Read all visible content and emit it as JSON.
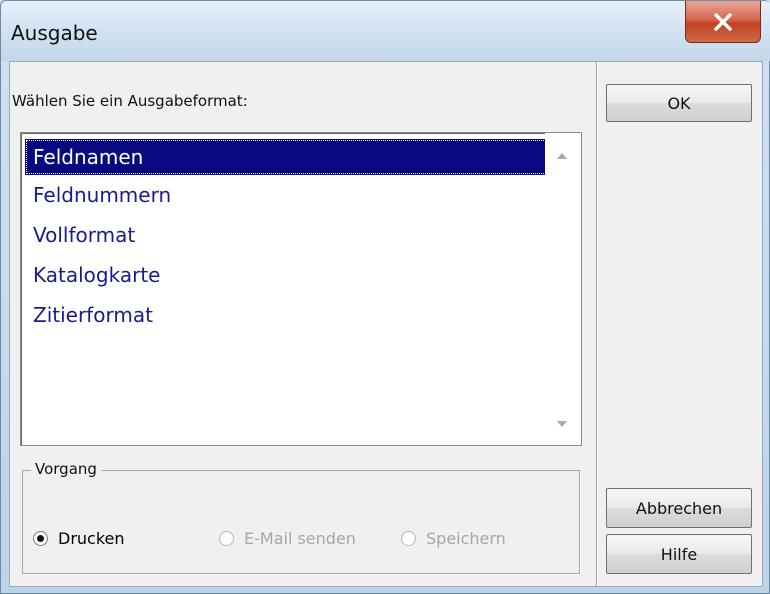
{
  "window": {
    "title": "Ausgabe"
  },
  "prompt": "Wählen Sie ein Ausgabeformat:",
  "formats": [
    {
      "label": "Feldnamen",
      "selected": true
    },
    {
      "label": "Feldnummern",
      "selected": false
    },
    {
      "label": "Vollformat",
      "selected": false
    },
    {
      "label": "Katalogkarte",
      "selected": false
    },
    {
      "label": "Zitierformat",
      "selected": false
    }
  ],
  "action_group": {
    "label": "Vorgang",
    "options": [
      {
        "label": "Drucken",
        "checked": true,
        "enabled": true
      },
      {
        "label": "E-Mail senden",
        "checked": false,
        "enabled": false
      },
      {
        "label": "Speichern",
        "checked": false,
        "enabled": false
      }
    ]
  },
  "buttons": {
    "ok": "OK",
    "cancel": "Abbrechen",
    "help": "Hilfe"
  },
  "colors": {
    "selection_bg": "#0a0a80",
    "list_text": "#1b1b8c",
    "close_button": "#c2421f"
  }
}
